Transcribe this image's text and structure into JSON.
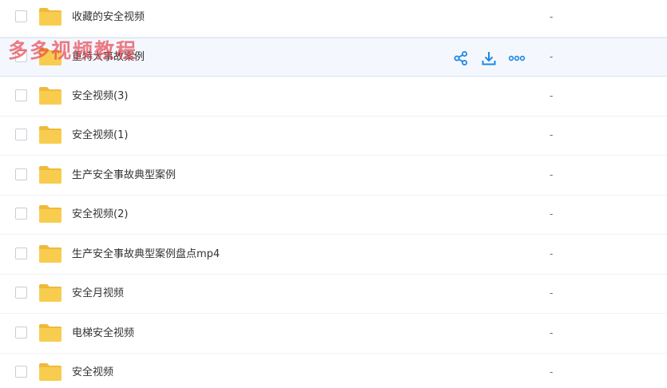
{
  "files": [
    {
      "name": "收藏的安全视频",
      "size": "-"
    },
    {
      "name": "重特大事故案例",
      "size": "-"
    },
    {
      "name": "安全视频(3)",
      "size": "-"
    },
    {
      "name": "安全视频(1)",
      "size": "-"
    },
    {
      "name": "生产安全事故典型案例",
      "size": "-"
    },
    {
      "name": "安全视频(2)",
      "size": "-"
    },
    {
      "name": "生产安全事故典型案例盘点mp4",
      "size": "-"
    },
    {
      "name": "安全月视频",
      "size": "-"
    },
    {
      "name": "电梯安全视频",
      "size": "-"
    },
    {
      "name": "安全视频",
      "size": "-"
    }
  ],
  "hover_actions": [
    "share-icon",
    "download-icon",
    "more-icon"
  ],
  "colors": {
    "folder": "#f8cd4f",
    "folder_tab": "#f0b93a",
    "action_icon": "#1f88e5",
    "watermark": "#e84a54"
  },
  "watermark": "多多视频教程"
}
